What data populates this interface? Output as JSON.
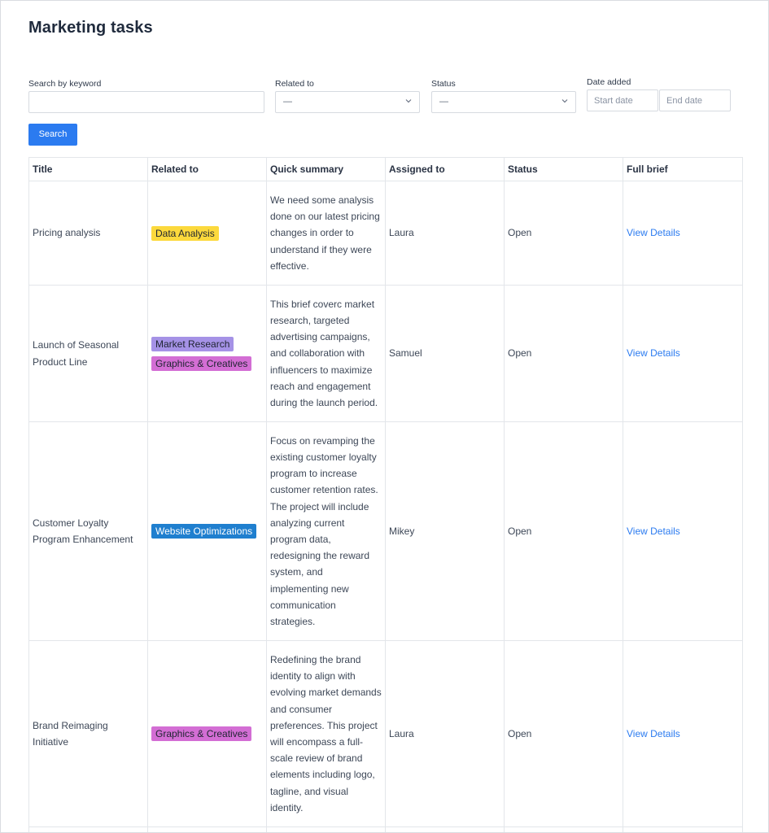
{
  "page": {
    "title": "Marketing tasks"
  },
  "filters": {
    "keyword": {
      "label": "Search by keyword",
      "value": ""
    },
    "related": {
      "label": "Related to",
      "value": "—"
    },
    "status": {
      "label": "Status",
      "value": "—"
    },
    "date": {
      "label": "Date added",
      "start_placeholder": "Start date",
      "end_placeholder": "End date"
    },
    "search_button": "Search"
  },
  "table": {
    "headers": [
      "Title",
      "Related to",
      "Quick summary",
      "Assigned to",
      "Status",
      "Full brief"
    ],
    "rows": [
      {
        "title": "Pricing analysis",
        "tags": [
          {
            "label": "Data Analysis",
            "color": "#fcd93c"
          }
        ],
        "summary": "We need some analysis done on our latest pricing changes in order to understand if they were effective.",
        "assigned": "Laura",
        "status": "Open",
        "link": "View Details"
      },
      {
        "title": "Launch of Seasonal Product Line",
        "tags": [
          {
            "label": "Market Research",
            "color": "#a592e6"
          },
          {
            "label": "Graphics & Creatives",
            "color": "#d36ed4"
          }
        ],
        "summary": "This brief coverc market research, targeted advertising campaigns, and collaboration with influencers to maximize reach and engagement during the launch period.",
        "assigned": "Samuel",
        "status": "Open",
        "link": "View Details"
      },
      {
        "title": "Customer Loyalty Program Enhancement",
        "tags": [
          {
            "label": "Website Optimizations",
            "color": "#1f7fcf",
            "text_color": "#ffffff"
          }
        ],
        "summary": "Focus on revamping the existing customer loyalty program to increase customer retention rates. The project will include analyzing current program data, redesigning the reward system, and implementing new communication strategies.",
        "assigned": "Mikey",
        "status": "Open",
        "link": "View Details"
      },
      {
        "title": "Brand Reimaging Initiative",
        "tags": [
          {
            "label": "Graphics & Creatives",
            "color": "#d36ed4"
          }
        ],
        "summary": "Redefining the brand identity to align with evolving market demands and consumer preferences. This project will encompass a full-scale review of brand elements including logo, tagline, and visual identity.",
        "assigned": "Laura",
        "status": "Open",
        "link": "View Details"
      }
    ]
  },
  "icons": {
    "select_chevron": "chevron-down-icon"
  }
}
